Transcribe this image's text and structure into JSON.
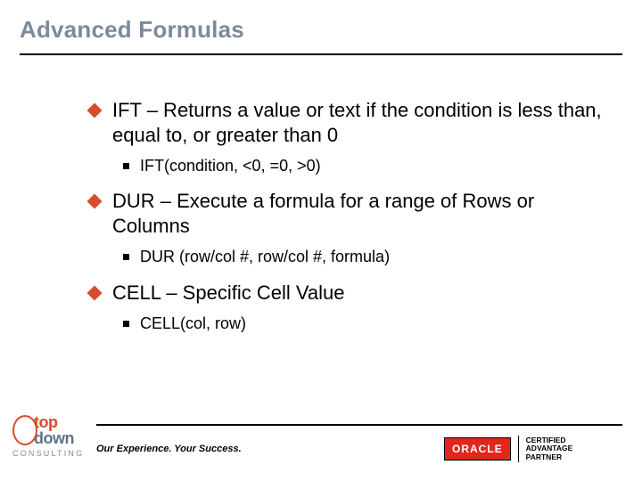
{
  "title": "Advanced Formulas",
  "items": [
    {
      "main": "IFT – Returns a value or text if the condition is less than, equal to, or greater than 0",
      "sub": "IFT(condition, <0, =0, >0)"
    },
    {
      "main": "DUR – Execute a formula for a range of Rows or Columns",
      "sub": "DUR (row/col #, row/col #, formula)"
    },
    {
      "main": "CELL – Specific Cell Value",
      "sub": "CELL(col, row)"
    }
  ],
  "tagline": "Our Experience. Your Success.",
  "logo_td": {
    "top": "top",
    "down": "down",
    "consulting": "CONSULTING"
  },
  "logo_ora": {
    "brand": "ORACLE",
    "line1": "CERTIFIED",
    "line2": "ADVANTAGE",
    "line3": "PARTNER"
  }
}
